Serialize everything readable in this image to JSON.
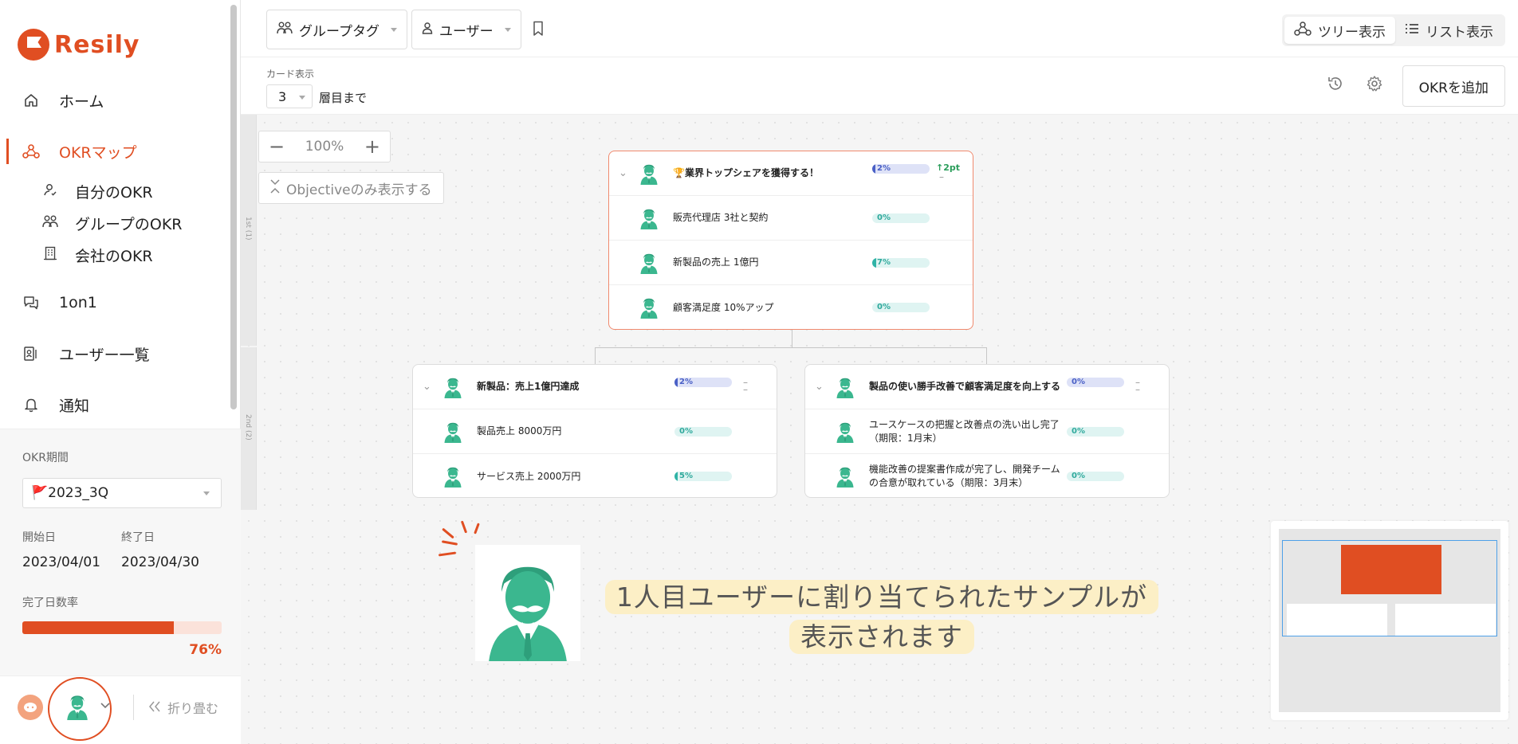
{
  "app": {
    "brand": "Resily"
  },
  "sidebar": {
    "nav": [
      {
        "label": "ホーム",
        "icon": "home-icon"
      },
      {
        "label": "OKRマップ",
        "icon": "okr-map-icon",
        "active": true
      },
      {
        "label": "1on1",
        "icon": "chat-icon"
      },
      {
        "label": "ユーザー一覧",
        "icon": "users-list-icon"
      },
      {
        "label": "通知",
        "icon": "bell-icon"
      }
    ],
    "sub_items": [
      {
        "label": "自分のOKR",
        "icon": "my-okr-icon"
      },
      {
        "label": "グループのOKR",
        "icon": "group-icon"
      },
      {
        "label": "会社のOKR",
        "icon": "building-icon"
      }
    ],
    "period": {
      "label": "OKR期間",
      "value": "🚩2023_3Q"
    },
    "start": {
      "label": "開始日",
      "value": "2023/04/01"
    },
    "end": {
      "label": "終了日",
      "value": "2023/04/30"
    },
    "completion": {
      "label": "完了日数率",
      "value": "76%",
      "fraction": 0.76
    },
    "collapse_label": "折り畳む"
  },
  "toolbar": {
    "group_tag": "グループタグ",
    "user": "ユーザー",
    "tree_view": "ツリー表示",
    "list_view": "リスト表示",
    "card_display_label": "カード表示",
    "card_depth": "3",
    "card_depth_suffix": "層目まで",
    "add_okr": "OKRを追加"
  },
  "canvas": {
    "zoom": "100%",
    "objective_only": "Objectiveのみ表示する",
    "lanes": [
      "1st (1)",
      "2nd (2)"
    ]
  },
  "okr_cards": {
    "top": {
      "objective": {
        "title": "🏆業界トップシェアを獲得する！",
        "progress": "2%",
        "progress_value": 0.02,
        "delta": "↑2pt"
      },
      "key_results": [
        {
          "title": "販売代理店 3社と契約",
          "progress": "0%",
          "progress_value": 0
        },
        {
          "title": "新製品の売上 1億円",
          "progress": "7%",
          "progress_value": 0.07
        },
        {
          "title": "顧客満足度 10%アップ",
          "progress": "0%",
          "progress_value": 0
        }
      ]
    },
    "left": {
      "objective": {
        "title": "新製品：売上1億円達成",
        "progress": "2%",
        "progress_value": 0.02
      },
      "key_results": [
        {
          "title": "製品売上 8000万円",
          "progress": "0%",
          "progress_value": 0
        },
        {
          "title": "サービス売上 2000万円",
          "progress": "5%",
          "progress_value": 0.05
        }
      ]
    },
    "right": {
      "objective": {
        "title": "製品の使い勝手改善で顧客満足度を向上する",
        "progress": "0%",
        "progress_value": 0
      },
      "key_results": [
        {
          "title": "ユースケースの把握と改善点の洗い出し完了（期限：1月末）",
          "progress": "0%",
          "progress_value": 0
        },
        {
          "title": "機能改善の提案書作成が完了し、開発チームの合意が取れている（期限：3月末）",
          "progress": "0%",
          "progress_value": 0
        }
      ]
    }
  },
  "annotation": {
    "line1": "1人目ユーザーに割り当てられたサンプルが",
    "line2": "表示されます"
  },
  "colors": {
    "accent": "#e04e22",
    "teal": "#2fb3a6",
    "avatar": "#3bb78f"
  }
}
